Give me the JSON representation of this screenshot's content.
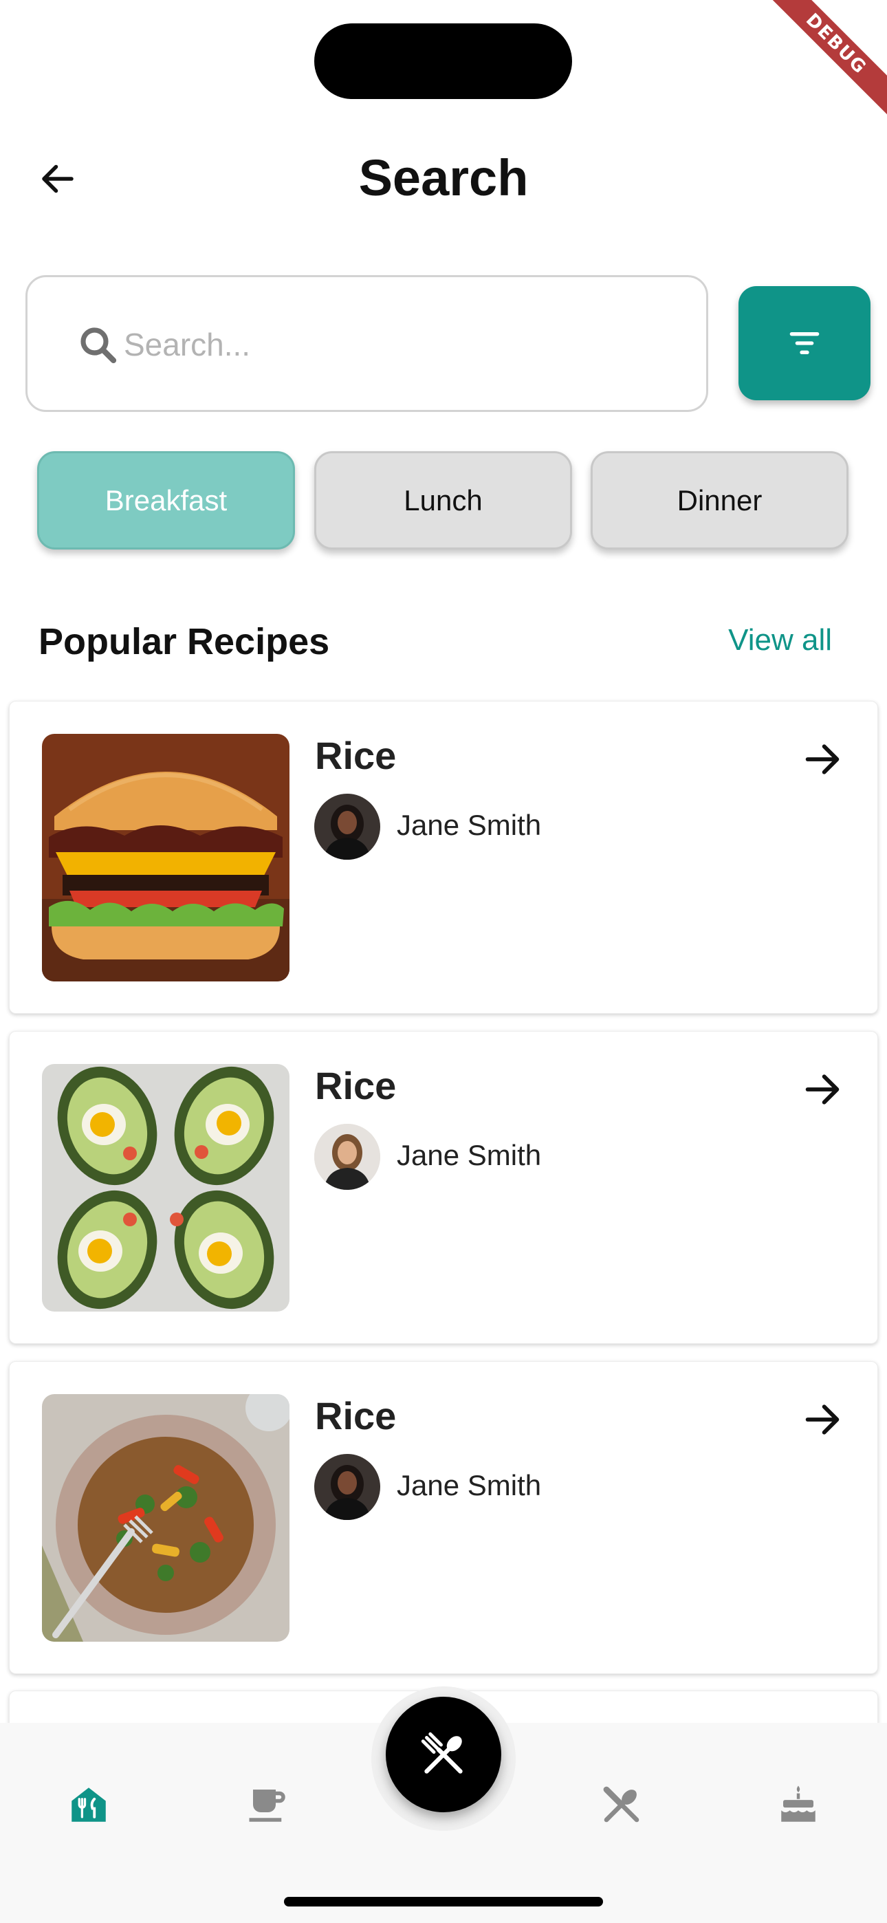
{
  "debug_banner": "DEBUG",
  "header": {
    "title": "Search"
  },
  "search": {
    "placeholder": "Search...",
    "value": ""
  },
  "chips": [
    {
      "label": "Breakfast",
      "active": true
    },
    {
      "label": "Lunch",
      "active": false
    },
    {
      "label": "Dinner",
      "active": false
    }
  ],
  "section": {
    "title": "Popular Recipes",
    "view_all": "View all"
  },
  "recipes": [
    {
      "title": "Rice",
      "author": "Jane Smith",
      "image": "burger"
    },
    {
      "title": "Rice",
      "author": "Jane Smith",
      "image": "avocado-eggs"
    },
    {
      "title": "Rice",
      "author": "Jane Smith",
      "image": "veggie-bowl"
    }
  ],
  "bottom_nav": {
    "items": [
      {
        "icon": "restaurant-menu-icon",
        "active": true
      },
      {
        "icon": "coffee-cup-icon",
        "active": false
      },
      {
        "icon": "spoon-knife-icon",
        "active": false
      },
      {
        "icon": "cake-icon",
        "active": false
      }
    ],
    "fab_icon": "utensils-cross-icon"
  },
  "colors": {
    "accent": "#0f9488",
    "chip_active": "#7ecbc2",
    "chip_inactive": "#e0e0e0",
    "nav_inactive": "#8a8a8a",
    "debug_ribbon": "#b43b3b"
  }
}
